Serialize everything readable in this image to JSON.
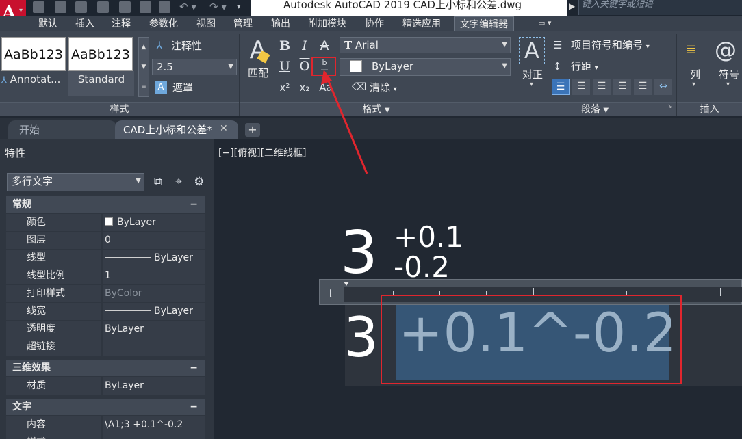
{
  "app": {
    "title": "Autodesk AutoCAD 2019      CAD上小标和公差.dwg",
    "search_placeholder": "键入关键字或短语",
    "logo": "A"
  },
  "ribbon_tabs": [
    "默认",
    "插入",
    "注释",
    "参数化",
    "视图",
    "管理",
    "输出",
    "附加模块",
    "协作",
    "精选应用",
    "文字编辑器"
  ],
  "ribbon": {
    "style_panel": {
      "style1_preview": "AaBb123",
      "style1_label": "Annotat...",
      "style2_preview": "AaBb123",
      "style2_label": "Standard",
      "annotative_label": "注释性",
      "text_height": "2.5",
      "mask_label": "遮罩",
      "footer": "样式"
    },
    "format_panel": {
      "match_label": "匹配",
      "font": "Arial",
      "color": "ByLayer",
      "clear_label": "清除",
      "footer": "格式",
      "buttons": {
        "bold": "B",
        "italic": "I",
        "strike": "A",
        "underline": "U",
        "overline": "O",
        "stack": "b/a",
        "superscript": "x²",
        "subscript": "x₂",
        "case": "Aa"
      }
    },
    "paragraph_panel": {
      "justify_label": "对正",
      "bullets_label": "项目符号和编号",
      "line_spacing_label": "行距",
      "footer": "段落"
    },
    "insert_panel": {
      "column_label": "列",
      "symbol_label": "符号",
      "footer": "插入"
    }
  },
  "doc_tabs": [
    "开始",
    "CAD上小标和公差*"
  ],
  "properties": {
    "title": "特性",
    "object_type": "多行文字",
    "sections": {
      "general": "常规",
      "threed": "三维效果",
      "text": "文字"
    },
    "general_rows": [
      {
        "key": "颜色",
        "value": "ByLayer"
      },
      {
        "key": "图层",
        "value": "0"
      },
      {
        "key": "线型",
        "value": "ByLayer"
      },
      {
        "key": "线型比例",
        "value": "1"
      },
      {
        "key": "打印样式",
        "value": "ByColor"
      },
      {
        "key": "线宽",
        "value": "ByLayer"
      },
      {
        "key": "透明度",
        "value": "ByLayer"
      },
      {
        "key": "超链接",
        "value": ""
      }
    ],
    "threed_rows": [
      {
        "key": "材质",
        "value": "ByLayer"
      }
    ],
    "text_rows": [
      {
        "key": "内容",
        "value": "\\A1;3 +0.1^-0.2"
      },
      {
        "key": "样式",
        "value": ""
      }
    ]
  },
  "canvas": {
    "view_label": "[−][俯视][二维线框]",
    "result_base": "3",
    "result_upper": "+0.1",
    "result_lower": "-0.2",
    "editor_base": "3",
    "editor_selected": "+0.1^-0.2"
  },
  "colors": {
    "highlight": "#e0262e",
    "selection": "#365676",
    "ribbon_bg": "#3f4753",
    "canvas_bg": "#212832"
  }
}
